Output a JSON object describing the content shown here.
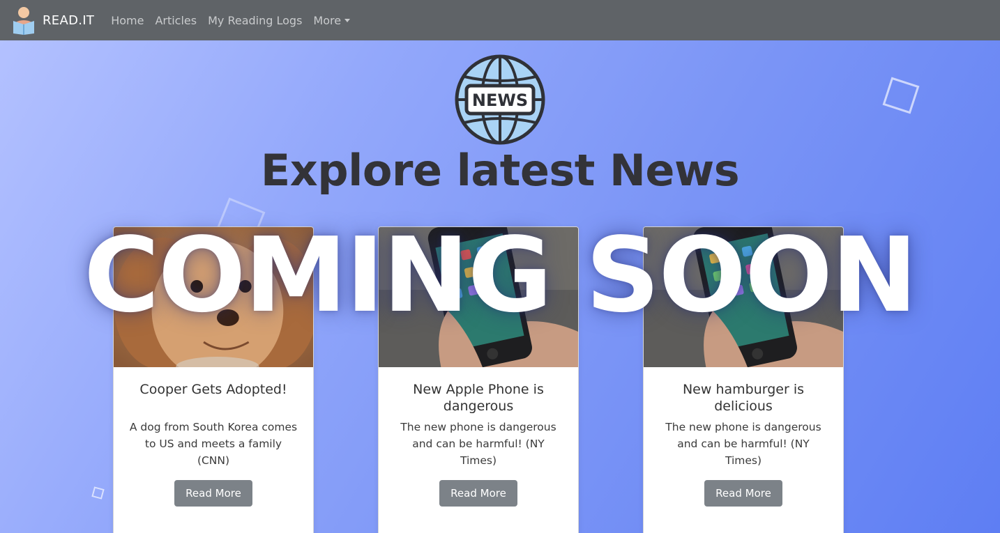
{
  "navbar": {
    "brand": "READ.IT",
    "links": [
      "Home",
      "Articles",
      "My Reading Logs",
      "More"
    ]
  },
  "hero": {
    "logo_text": "NEWS",
    "title": "Explore latest News",
    "overlay": "COMING SOON"
  },
  "cards": [
    {
      "title": "Cooper Gets Adopted!",
      "text": "A dog from South Korea comes to US and meets a family (CNN)",
      "button": "Read More",
      "image": "dog-photo"
    },
    {
      "title": "New Apple Phone is dangerous",
      "text": "The new phone is dangerous and can be harmful! (NY Times)",
      "button": "Read More",
      "image": "phone-photo"
    },
    {
      "title": "New hamburger is delicious",
      "text": "The new phone is dangerous and can be harmful! (NY Times)",
      "button": "Read More",
      "image": "phone-photo"
    }
  ],
  "colors": {
    "navbar": "#5f6367",
    "hero_gradient_start": "#b3c1ff",
    "hero_gradient_end": "#5e7ef3",
    "button": "#7c8288",
    "title": "#333338"
  }
}
